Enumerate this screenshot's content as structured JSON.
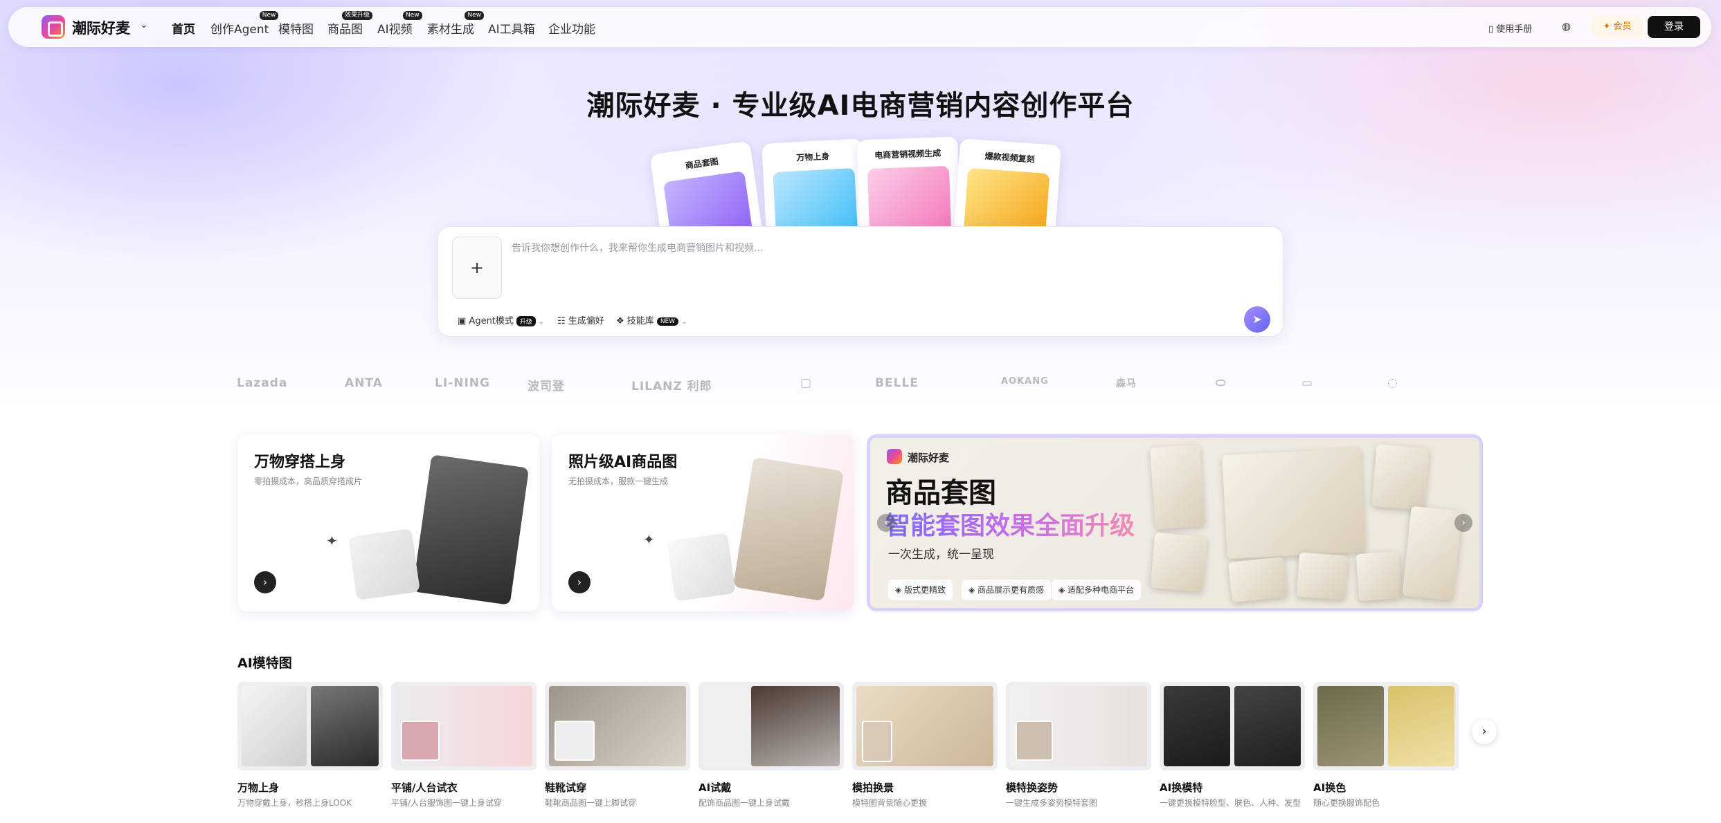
{
  "nav": {
    "brand": "潮际好麦",
    "items": [
      {
        "label": "首页",
        "badge": ""
      },
      {
        "label": "创作Agent",
        "badge": "New"
      },
      {
        "label": "模特图",
        "badge": ""
      },
      {
        "label": "商品图",
        "badge": "效果升级"
      },
      {
        "label": "AI视频",
        "badge": "New"
      },
      {
        "label": "素材生成",
        "badge": "New"
      },
      {
        "label": "AI工具箱",
        "badge": ""
      },
      {
        "label": "企业功能",
        "badge": ""
      }
    ],
    "manual": "使用手册",
    "vip": "会员",
    "login": "登录"
  },
  "hero": {
    "title": "潮际好麦 · 专业级AI电商营销内容创作平台",
    "cards": [
      "商品套图",
      "万物上身",
      "电商营销视频生成",
      "爆款视频复刻"
    ]
  },
  "prompt": {
    "placeholder": "告诉我你想创作什么，我来帮你生成电商营销图片和视频...",
    "tools": {
      "agent": "Agent模式",
      "agent_tag": "升级",
      "preference": "生成偏好",
      "skills": "技能库",
      "skills_tag": "NEW"
    }
  },
  "brand_logos": [
    "Lazada",
    "ANTA",
    "LI-NING",
    "波司登",
    "LILANZ 利郎",
    "",
    "BELLE",
    "AOKANG",
    "森马",
    "",
    "",
    ""
  ],
  "banners": {
    "outfit": {
      "title": "万物穿搭上身",
      "subtitle": "零拍摄成本，高品质穿搭成片"
    },
    "product": {
      "title": "照片级AI商品图",
      "subtitle": "无拍摄成本，服款一键生成"
    },
    "promo": {
      "brand": "潮际好麦",
      "title": "商品套图",
      "subtitle": "智能套图效果全面升级",
      "handwriting": "一次生成，统一呈现",
      "chips": [
        "版式更精致",
        "商品展示更有质感",
        "适配多种电商平台"
      ]
    }
  },
  "model_section": {
    "title": "AI模特图",
    "tiles": [
      {
        "name": "万物上身",
        "desc": "万物穿戴上身，秒搭上身LOOK"
      },
      {
        "name": "平铺/人台试衣",
        "desc": "平铺/人台服饰图一键上身试穿"
      },
      {
        "name": "鞋靴试穿",
        "desc": "鞋靴商品图一键上脚试穿"
      },
      {
        "name": "AI试戴",
        "desc": "配饰商品图一键上身试戴"
      },
      {
        "name": "模拍换景",
        "desc": "模特图背景随心更换"
      },
      {
        "name": "模特换姿势",
        "desc": "一键生成多姿势模特套图"
      },
      {
        "name": "AI换模特",
        "desc": "一键更换模特脸型、肤色、人种、发型"
      },
      {
        "name": "AI换色",
        "desc": "随心更换服饰配色"
      }
    ]
  },
  "colors": {
    "accent": "#6366f1",
    "vip": "#d97706",
    "dark": "#111111"
  }
}
